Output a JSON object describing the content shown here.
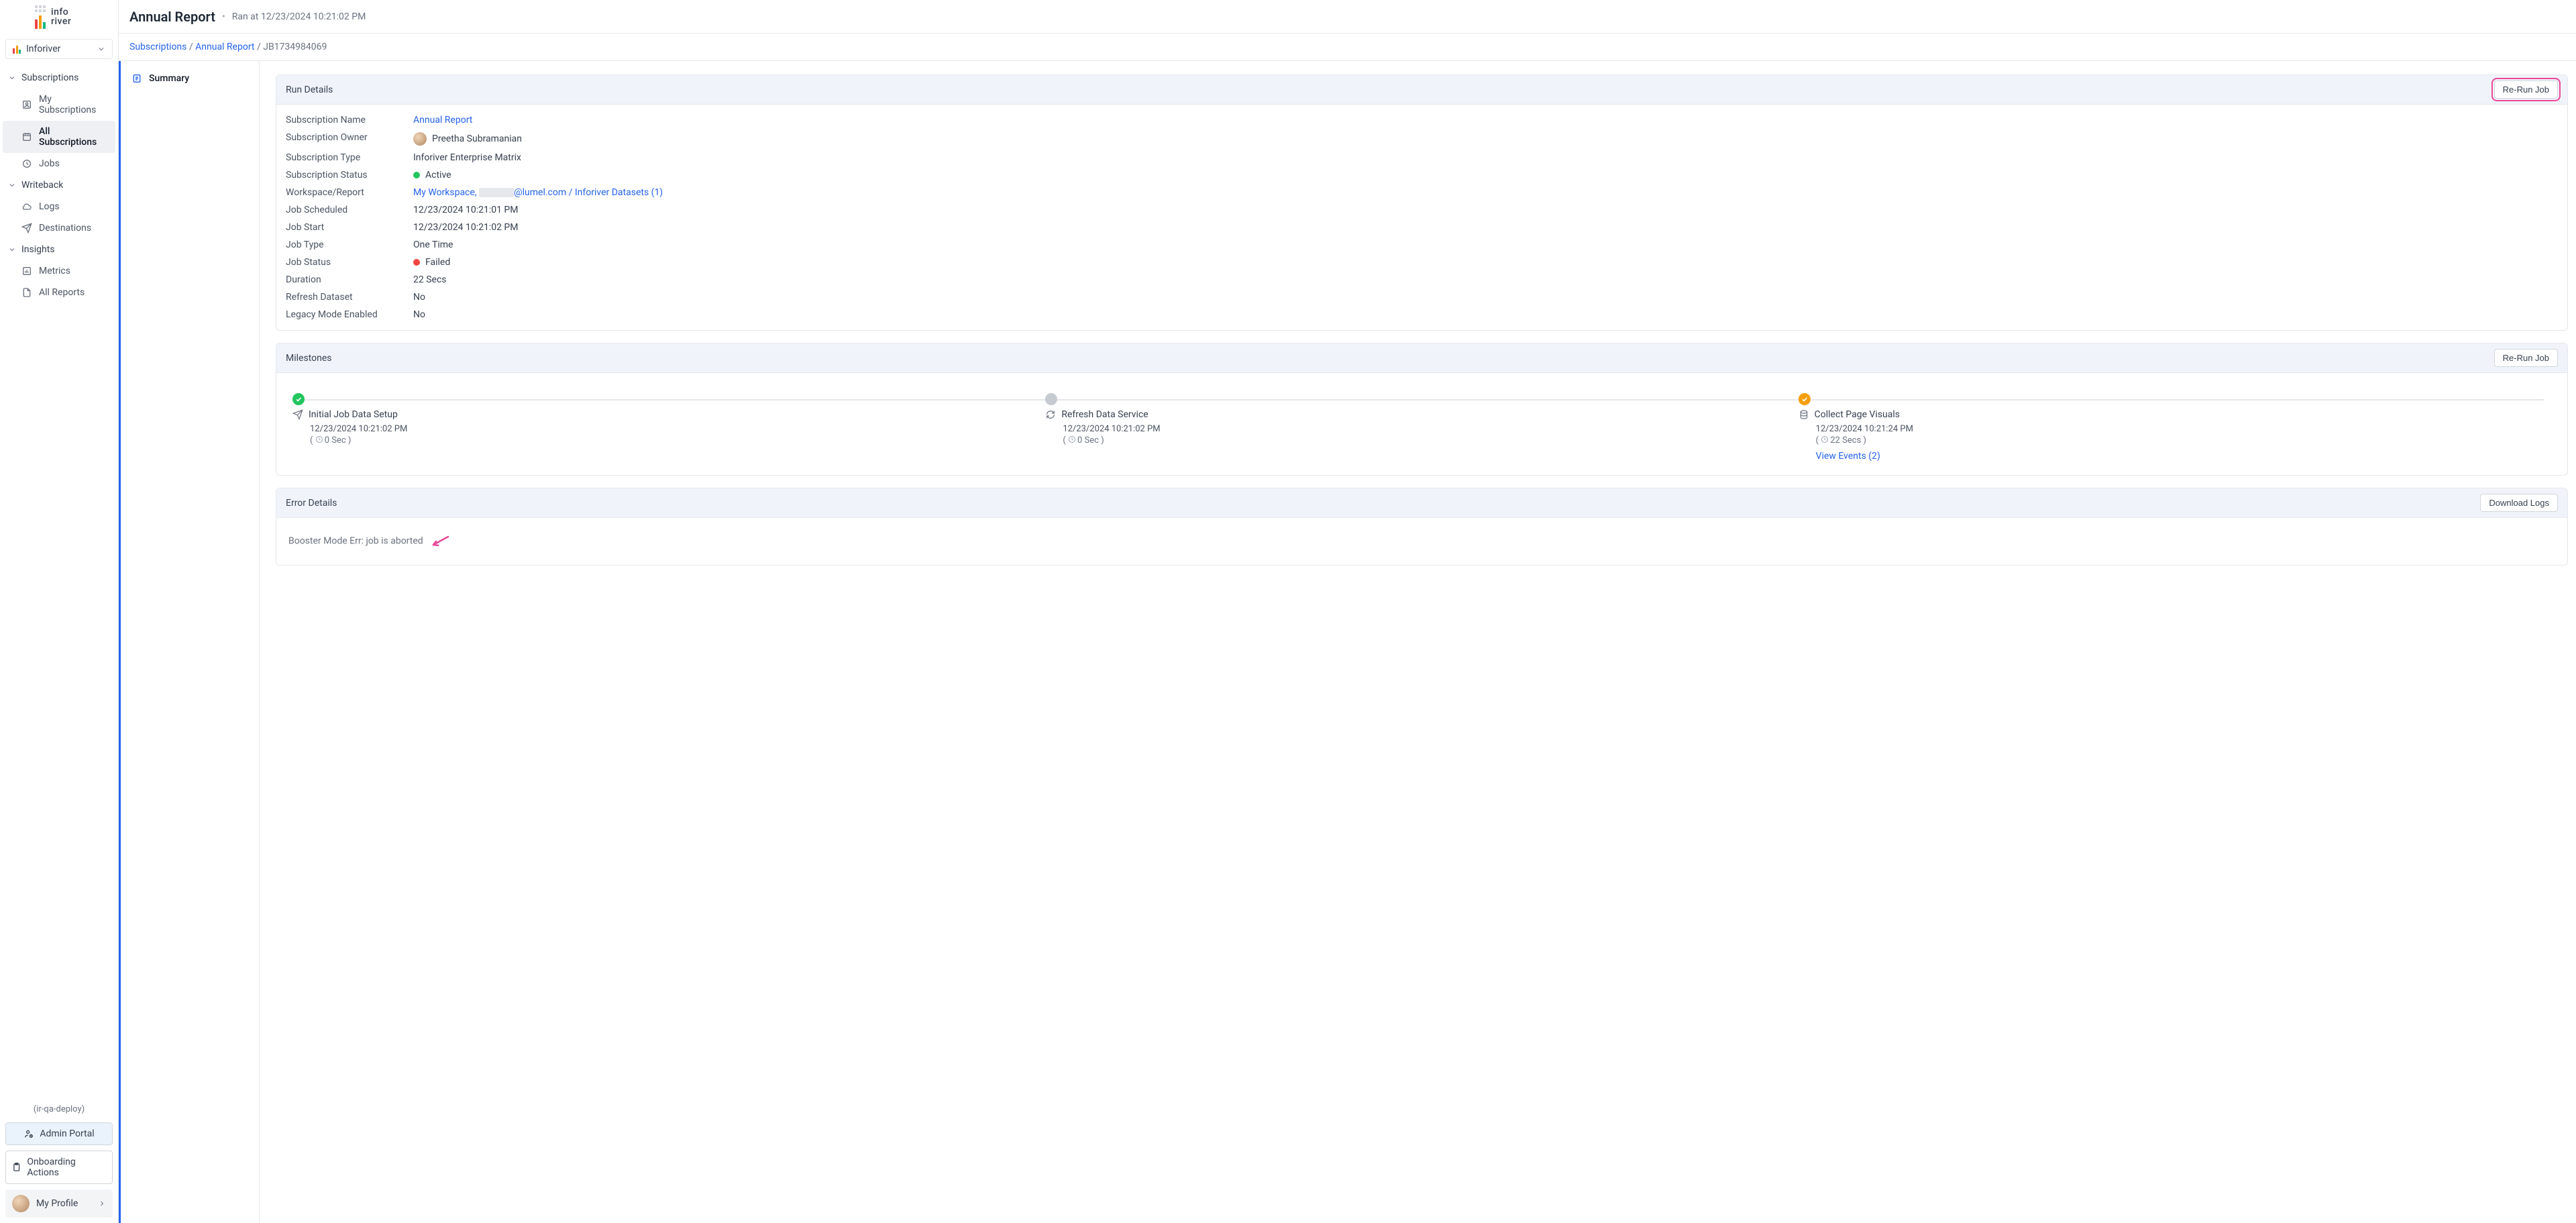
{
  "brand": {
    "name1": "info",
    "name2": "river",
    "workspace": "Inforiver"
  },
  "sidebar": {
    "sections": {
      "subscriptions": {
        "label": "Subscriptions",
        "items": [
          "My Subscriptions",
          "All Subscriptions",
          "Jobs"
        ]
      },
      "writeback": {
        "label": "Writeback",
        "items": [
          "Logs",
          "Destinations"
        ]
      },
      "insights": {
        "label": "Insights",
        "items": [
          "Metrics",
          "All Reports"
        ]
      }
    },
    "env": "(ir-qa-deploy)",
    "adminPortal": "Admin Portal",
    "onboarding": "Onboarding Actions",
    "profile": "My Profile"
  },
  "header": {
    "title": "Annual Report",
    "ranAtLabel": "Ran at 12/23/2024 10:21:02 PM"
  },
  "breadcrumb": {
    "a": "Subscriptions",
    "b": "Annual Report",
    "c": "JB1734984069"
  },
  "leftTab": {
    "summary": "Summary"
  },
  "runDetails": {
    "heading": "Run Details",
    "rerun": "Re-Run Job",
    "rows": {
      "subName": {
        "label": "Subscription Name",
        "value": "Annual Report"
      },
      "subOwner": {
        "label": "Subscription Owner",
        "value": "Preetha Subramanian"
      },
      "subType": {
        "label": "Subscription Type",
        "value": "Inforiver Enterprise Matrix"
      },
      "subStatus": {
        "label": "Subscription Status",
        "value": "Active"
      },
      "wsReport": {
        "label": "Workspace/Report",
        "p1": "My Workspace, ",
        "p2": "@lumel.com / Inforiver Datasets (1)"
      },
      "scheduled": {
        "label": "Job Scheduled",
        "value": "12/23/2024 10:21:01 PM"
      },
      "start": {
        "label": "Job Start",
        "value": "12/23/2024 10:21:02 PM"
      },
      "type": {
        "label": "Job Type",
        "value": "One Time"
      },
      "status": {
        "label": "Job Status",
        "value": "Failed"
      },
      "duration": {
        "label": "Duration",
        "value": "22 Secs"
      },
      "refresh": {
        "label": "Refresh Dataset",
        "value": "No"
      },
      "legacy": {
        "label": "Legacy Mode Enabled",
        "value": "No"
      }
    }
  },
  "milestones": {
    "heading": "Milestones",
    "rerun": "Re-Run Job",
    "steps": [
      {
        "title": "Initial Job Data Setup",
        "ts": "12/23/2024 10:21:02 PM",
        "dur": "0 Sec"
      },
      {
        "title": "Refresh Data Service",
        "ts": "12/23/2024 10:21:02 PM",
        "dur": "0 Sec"
      },
      {
        "title": "Collect Page Visuals",
        "ts": "12/23/2024 10:21:24 PM",
        "dur": "22 Secs",
        "events": "View Events (2)"
      }
    ]
  },
  "errorDetails": {
    "heading": "Error Details",
    "download": "Download Logs",
    "message": "Booster Mode Err: job is aborted"
  }
}
